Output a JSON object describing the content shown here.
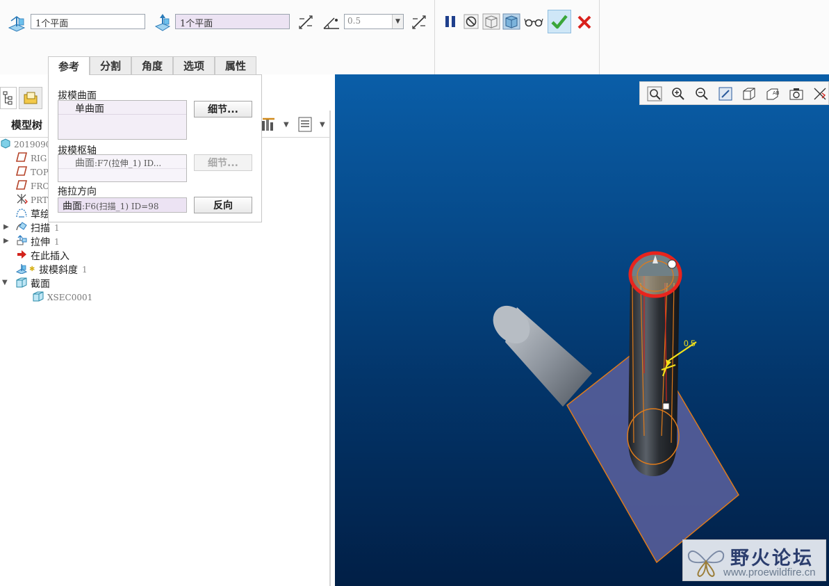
{
  "dashboard": {
    "reference_plane_1": "1个平面",
    "reference_plane_2": "1个平面",
    "draft_angle": "0.5",
    "colors": {
      "accent_green": "#3aa63a",
      "cancel_red": "#d9211c",
      "selected_field": "#ece3f3"
    }
  },
  "tabs": [
    {
      "label": "参考"
    },
    {
      "label": "分割"
    },
    {
      "label": "角度"
    },
    {
      "label": "选项"
    },
    {
      "label": "属性"
    }
  ],
  "model_tree": {
    "header": "模型树",
    "items": [
      {
        "label": "2019090",
        "icon": "part-icon"
      },
      {
        "label": "RIG",
        "icon": "datum-plane-icon"
      },
      {
        "label": "TOP",
        "icon": "datum-plane-icon"
      },
      {
        "label": "FRO",
        "icon": "datum-plane-icon"
      },
      {
        "label": "PRT",
        "icon": "coordinate-system-icon"
      },
      {
        "label": "草绘",
        "icon": "sketch-icon"
      },
      {
        "label": "扫描",
        "count": "1",
        "icon": "sweep-icon"
      },
      {
        "label": "拉伸",
        "count": "1",
        "icon": "extrude-icon"
      },
      {
        "label": "在此插入",
        "icon": "insert-here-arrow-icon"
      },
      {
        "label": "拔模斜度",
        "count": "1",
        "icon": "draft-icon"
      },
      {
        "label": "截面",
        "icon": "cross-section-icon"
      },
      {
        "label": "XSEC0001",
        "icon": "xsec-icon"
      }
    ]
  },
  "ref_panel": {
    "draft_surfaces_label": "拔模曲面",
    "draft_surfaces_item": "单曲面",
    "details_button": "细节...",
    "draft_hinges_label": "拔模枢轴",
    "draft_hinges_item_prefix": "曲面",
    "draft_hinges_item_detail": ":F7(拉伸_1) ID...",
    "details_button_2": "细节...",
    "pull_direction_label": "拖拉方向",
    "pull_direction_prefix": "曲面",
    "pull_direction_detail": ":F6(扫描_1) ID=98",
    "flip_button": "反向"
  },
  "viewport": {
    "angle_annotation": "0.5",
    "watermark_title": "野火论坛",
    "watermark_url": "www.proewildfire.cn"
  }
}
